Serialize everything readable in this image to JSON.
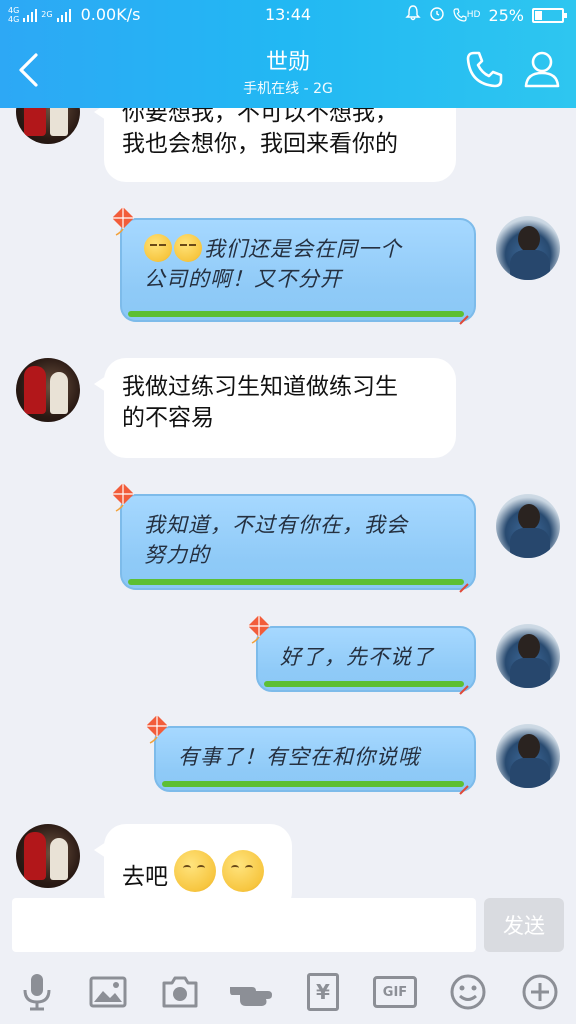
{
  "status_bar": {
    "network_top": "4G",
    "network_bottom": "4G",
    "network2": "2G",
    "speed": "0.00K/s",
    "time": "13:44",
    "hd": "HD",
    "battery": "25%",
    "battery_level": 0.25
  },
  "header": {
    "title": "世勋",
    "subtitle": "手机在线 - 2G"
  },
  "messages": [
    {
      "side": "left",
      "text_lines": [
        "你要想我，不可以不想我，",
        "我也会想你，我回来看你的"
      ]
    },
    {
      "side": "right",
      "text_lines": [
        "我们还是会在同一个",
        "公司的啊！又不分开"
      ],
      "emoji_prefix": [
        "unamused-emoji",
        "unamused-emoji"
      ]
    },
    {
      "side": "left",
      "text_lines": [
        "我做过练习生知道做练习生",
        "的不容易"
      ]
    },
    {
      "side": "right",
      "text_lines": [
        "我知道，不过有你在，我会",
        "努力的"
      ]
    },
    {
      "side": "right",
      "text_lines": [
        "好了，先不说了"
      ]
    },
    {
      "side": "right",
      "text_lines": [
        "有事了！有空在和你说哦"
      ]
    },
    {
      "side": "left",
      "text_lines": [
        "去吧"
      ],
      "emoji_suffix": [
        "kiss-emoji",
        "kiss-emoji"
      ]
    }
  ],
  "input": {
    "value": "",
    "send_label": "发送"
  },
  "toolbar": {
    "items": [
      "microphone-icon",
      "image-icon",
      "camera-icon",
      "poke-icon",
      "red-packet-icon",
      "gif-icon",
      "emoji-icon",
      "plus-icon"
    ],
    "gif_label": "GIF",
    "yen_label": "¥"
  },
  "colors": {
    "header_start": "#2da8f5",
    "header_end": "#2ec6f0",
    "chat_bg": "#eef0f6",
    "bubble_sky": "#a6d8ff",
    "grass": "#5dbf34",
    "send_disabled": "#d9dbe0"
  }
}
